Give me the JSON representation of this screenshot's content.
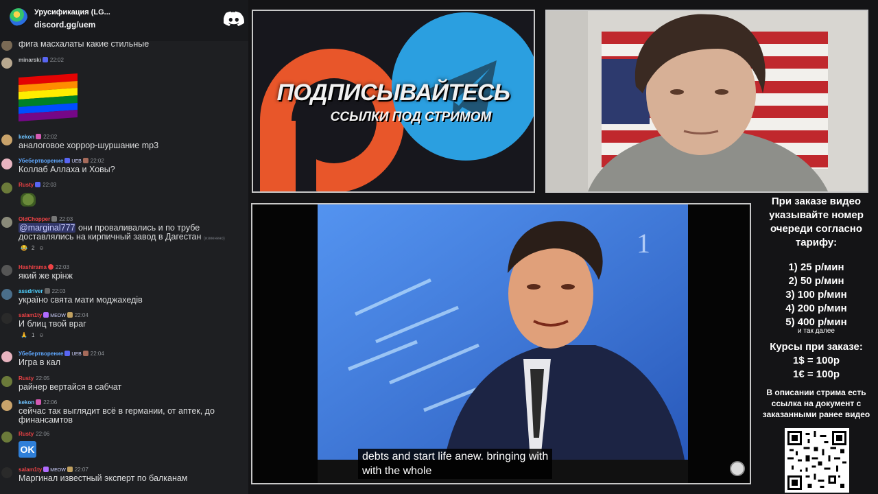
{
  "chat": {
    "server_name": "Урусификация (LG...",
    "invite": "discord.gg/uem",
    "top_partial_text": "фига масхалаты какие стильные",
    "messages": [
      {
        "user": "minarski",
        "user_color": "#b9bbbe",
        "time": "22:02",
        "text": ""
      },
      {
        "user": "kekon",
        "user_color": "#6fc3ff",
        "time": "22:02",
        "text": "аналоговое хоррор-шуршание mp3"
      },
      {
        "user": "Убебертворение",
        "user_color": "#5fa8ff",
        "tag": "UEB",
        "time": "22:02",
        "text": "Коллаб Аллаха и Ховы?"
      },
      {
        "user": "Rusty",
        "user_color": "#ed4245",
        "time": "22:03",
        "text": ""
      },
      {
        "user": "OldChopper",
        "user_color": "#ed4245",
        "time": "22:03",
        "mention": "@marginal777",
        "text": " они проваливались и по трубе доставлялись на кирпичный завод в Дагестан",
        "edited": "(изменено)",
        "reaction_count": "2"
      },
      {
        "user": "Hashirama",
        "user_color": "#ed4245",
        "time": "22:03",
        "text": "який же крінж"
      },
      {
        "user": "assdriver",
        "user_color": "#4fd1ff",
        "time": "22:03",
        "text": "україно свята мати моджахедів"
      },
      {
        "user": "salam1ty",
        "user_color": "#ed4245",
        "tag": "MEOW",
        "time": "22:04",
        "text": "И блиц твой враг",
        "reaction_count": "1"
      },
      {
        "user": "Убебертворение",
        "user_color": "#5fa8ff",
        "tag": "UEB",
        "time": "22:04",
        "text": "Игра в кал"
      },
      {
        "user": "Rusty",
        "user_color": "#ed4245",
        "time": "22:05",
        "text": "райнер вертайся в сабчат"
      },
      {
        "user": "kekon",
        "user_color": "#6fc3ff",
        "time": "22:06",
        "text": "сейчас так выглядит всё в германии, от аптек, до финансамтов"
      },
      {
        "user": "Rusty",
        "user_color": "#ed4245",
        "time": "22:06",
        "text": ""
      },
      {
        "user": "salam1ty",
        "user_color": "#ed4245",
        "tag": "MEOW",
        "time": "22:07",
        "text": "Маргинал известный эксперт по балканам"
      }
    ],
    "ok_emoji": "OK"
  },
  "promo": {
    "title": "ПОДПИСЫВАЙТЕСЬ",
    "subtitle": "ССЫЛКИ ПОД СТРИМОМ"
  },
  "video": {
    "subtitle_line1": "debts and start life anew. bringing with",
    "subtitle_line2": "with the whole"
  },
  "sidebar": {
    "order_info": "При заказе видео указывайте номер очереди согласно тарифу:",
    "tariffs": [
      "1) 25 р/мин",
      "2) 50 р/мин",
      "3) 100 р/мин",
      "4) 200 р/мин",
      "5) 400 р/мин"
    ],
    "tariffs_more": "и так далее",
    "rates_title": "Курсы при заказе:",
    "rates": [
      "1$ = 100р",
      "1€ = 100р"
    ],
    "description": "В описании стрима есть ссылка на документ с заказанными ранее видео"
  },
  "colors": {
    "discord_blurple": "#5865f2",
    "chat_bg": "#1e1f22",
    "patreon_orange": "#e8562a",
    "telegram_blue": "#2b9fe0"
  }
}
